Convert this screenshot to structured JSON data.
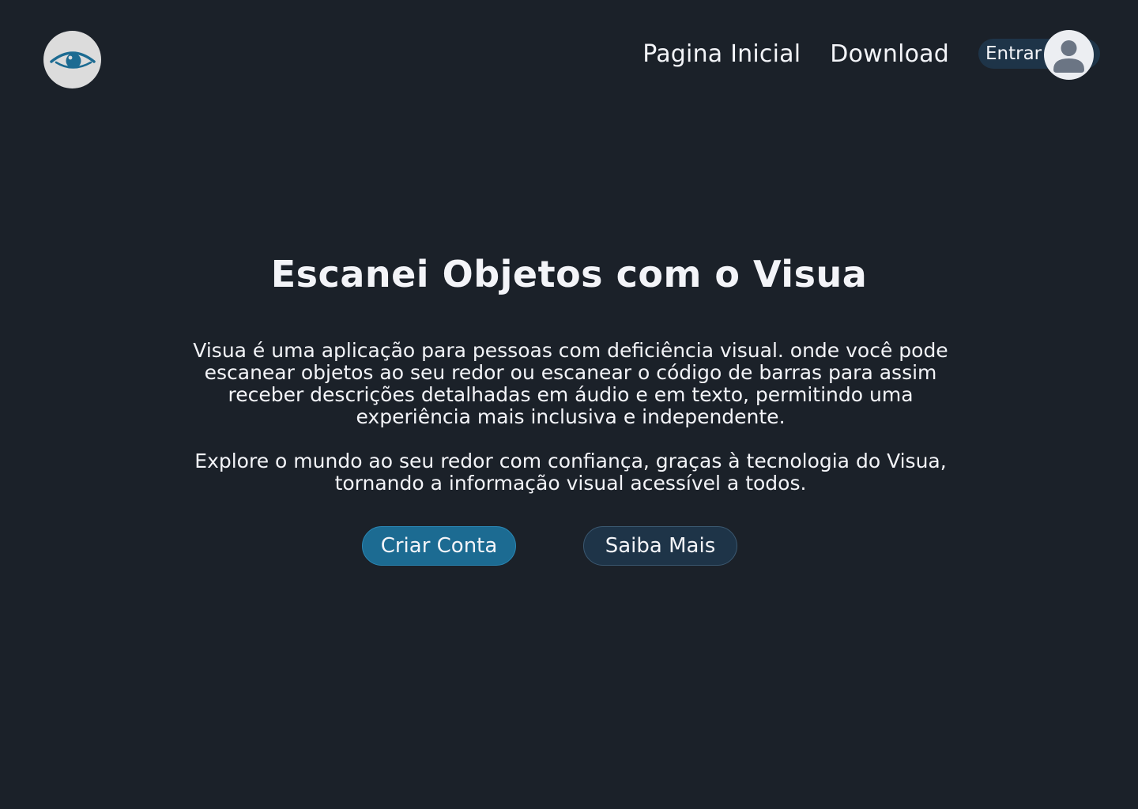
{
  "header": {
    "logo_icon": "eye-icon",
    "nav": [
      {
        "label": "Pagina Inicial"
      },
      {
        "label": "Download"
      }
    ],
    "login": {
      "label": "Entrar",
      "avatar_icon": "user-icon"
    }
  },
  "hero": {
    "title": "Escanei Objetos com o Visua",
    "paragraphs": [
      "Visua é uma aplicação para pessoas com deficiência visual. onde você pode escanear objetos ao seu redor ou escanear o código de barras para assim receber descrições detalhadas em áudio e em texto, permitindo uma experiência mais inclusiva e independente.",
      "Explore o mundo ao seu redor com confiança, graças à tecnologia do Visua, tornando a informação visual acessível a todos."
    ],
    "primary_button": "Criar Conta",
    "secondary_button": "Saiba Mais"
  },
  "colors": {
    "background": "#1b2129",
    "accent": "#1c6b92",
    "secondary": "#1e3448",
    "text": "#f3f4f8"
  }
}
